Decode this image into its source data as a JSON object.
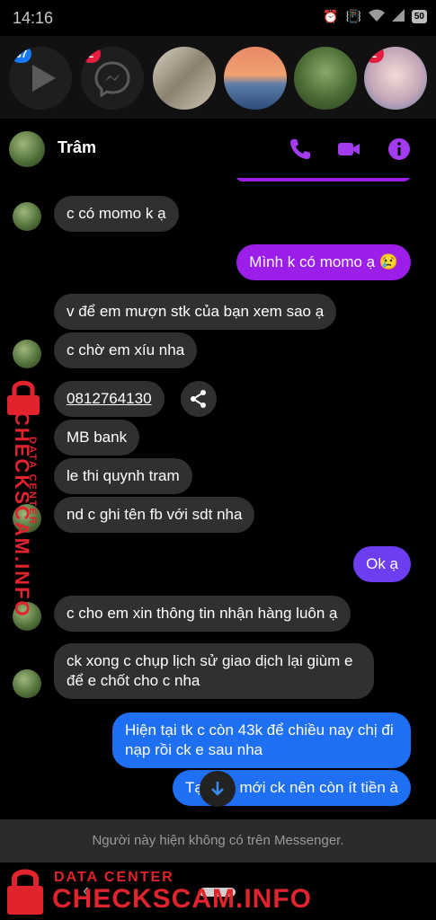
{
  "status_bar": {
    "time": "14:16",
    "battery": "50"
  },
  "chat_heads": [
    {
      "name": "video-chat-head",
      "badge": "37"
    },
    {
      "name": "messenger-chat-head",
      "badge": "2"
    },
    {
      "name": "group-chat-head",
      "badge": ""
    },
    {
      "name": "sunset-chat-head",
      "badge": ""
    },
    {
      "name": "forest-chat-head",
      "badge": ""
    },
    {
      "name": "portrait-chat-head",
      "badge": "2"
    }
  ],
  "header": {
    "contact_name": "Trâm"
  },
  "messages": [
    {
      "side": "in",
      "text": "c có momo k ạ"
    },
    {
      "side": "out",
      "text": "Mình k có momo ạ 😢"
    },
    {
      "side": "in",
      "text": "v để em mượn stk của bạn xem sao ạ"
    },
    {
      "side": "in",
      "text": "c chờ em xíu nha"
    },
    {
      "side": "in",
      "text": "0812764130"
    },
    {
      "side": "in",
      "text": "MB bank"
    },
    {
      "side": "in",
      "text": "le thi quynh tram"
    },
    {
      "side": "in",
      "text": "nd c ghi tên fb với sdt nha"
    },
    {
      "side": "out",
      "text": "Ok ạ"
    },
    {
      "side": "in",
      "text": "c cho em xin thông tin nhận hàng luôn ạ"
    },
    {
      "side": "in",
      "text": "ck xong c chụp lịch sử giao dịch lại giùm e để e chốt cho c nha"
    },
    {
      "side": "out",
      "text": "Hiện tại tk c còn 43k để chiều nay chị đi nạp rồi ck e sau nha"
    },
    {
      "side": "out",
      "text": "Tại nãy mới ck nên còn ít tiền à"
    }
  ],
  "notice": "Người này hiện không có trên Messenger.",
  "watermark": {
    "small": "DATA CENTER",
    "big": "CHECKSCAM.INFO"
  },
  "colors": {
    "purple_bubble": "#9b1fe8",
    "violet_bubble": "#6c3ef0",
    "blue_bubble": "#1f6ff2",
    "accent_icon": "#a33cf0"
  }
}
